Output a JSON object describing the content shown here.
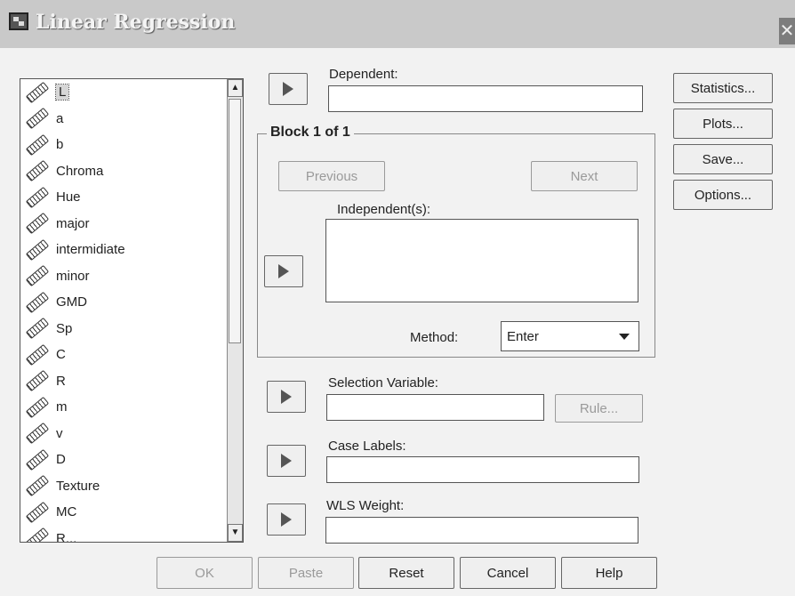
{
  "window": {
    "title": "Linear Regression"
  },
  "variables": [
    "L",
    "a",
    "b",
    "Chroma",
    "Hue",
    "major",
    "intermidiate",
    "minor",
    "GMD",
    "Sp",
    "C",
    "R",
    "m",
    "v",
    "D",
    "Texture",
    "MC",
    "R..."
  ],
  "dependent": {
    "label": "Dependent:",
    "value": ""
  },
  "block": {
    "title": "Block 1 of 1",
    "previous_label": "Previous",
    "next_label": "Next",
    "independents_label": "Independent(s):",
    "method_label": "Method:",
    "method_value": "Enter"
  },
  "selection_variable": {
    "label": "Selection Variable:",
    "value": "",
    "rule_label": "Rule..."
  },
  "case_labels": {
    "label": "Case Labels:",
    "value": ""
  },
  "wls_weight": {
    "label": "WLS Weight:",
    "value": ""
  },
  "side_buttons": {
    "statistics": "Statistics...",
    "plots": "Plots...",
    "save": "Save...",
    "options": "Options..."
  },
  "bottom_buttons": {
    "ok": "OK",
    "paste": "Paste",
    "reset": "Reset",
    "cancel": "Cancel",
    "help": "Help"
  }
}
